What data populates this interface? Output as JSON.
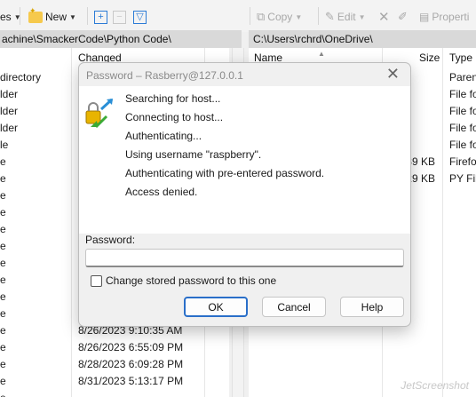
{
  "toolbar": {
    "left_truncated": "es",
    "new_label": "New",
    "copy_label": "Copy",
    "edit_label": "Edit",
    "properties_label": "Properti"
  },
  "left_panel": {
    "path": "achine\\SmackerCode\\Python Code\\",
    "column_changed": "Changed",
    "names": [
      " directory",
      "lder",
      "lder",
      "lder",
      "le",
      "e",
      "e",
      "e",
      "e",
      "e",
      "e",
      "e",
      "e",
      "e",
      "e",
      "e",
      "e",
      "e",
      "e",
      "e"
    ],
    "dates": [
      "",
      "",
      "",
      "",
      "",
      "",
      "",
      "",
      "",
      "",
      "",
      "",
      "",
      "",
      "",
      "8/26/2023 9:10:35 AM",
      "8/26/2023 6:55:09 PM",
      "8/28/2023 6:09:28 PM",
      "8/31/2023 5:13:17 PM",
      ""
    ]
  },
  "right_panel": {
    "path": "C:\\Users\\rchrd\\OneDrive\\",
    "column_name": "Name",
    "column_size": "Size",
    "column_type": "Type",
    "rows": [
      {
        "size": "",
        "type": "Paren"
      },
      {
        "size": "",
        "type": "File fo"
      },
      {
        "size": "",
        "type": "File fo"
      },
      {
        "size": "",
        "type": "File fo"
      },
      {
        "size": "",
        "type": "File fo"
      },
      {
        "size": "89 KB",
        "type": "Firefo"
      },
      {
        "size": "29 KB",
        "type": "PY Fil"
      }
    ]
  },
  "dialog": {
    "title": "Password – Rasberry@127.0.0.1",
    "log": [
      "Searching for host...",
      "Connecting to host...",
      "Authenticating...",
      "Using username \"raspberry\".",
      "Authenticating with pre-entered password.",
      "Access denied."
    ],
    "password_label": "Password:",
    "password_value": "",
    "checkbox_label": "Change stored password to this one",
    "checkbox_checked": false,
    "ok_label": "OK",
    "cancel_label": "Cancel",
    "help_label": "Help"
  },
  "watermark": "JetScreenshot",
  "colors": {
    "accent": "#2a6fc9",
    "folder": "#f6c94c"
  }
}
